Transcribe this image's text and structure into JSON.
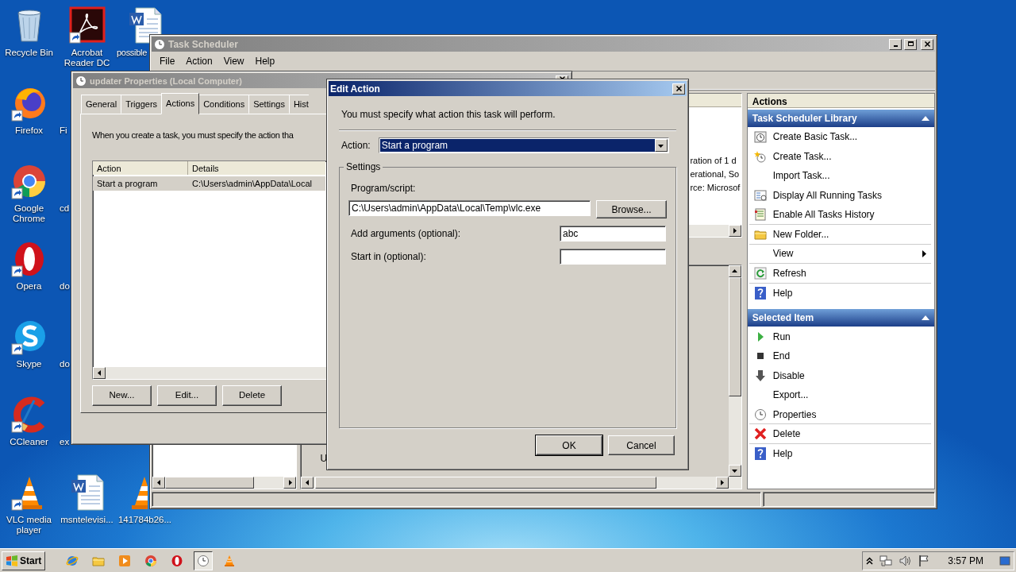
{
  "desktop": {
    "icon_columns": [
      [
        {
          "label": "Recycle Bin",
          "kind": "recycle",
          "shortcut": false
        },
        {
          "label": "Firefox",
          "kind": "firefox",
          "shortcut": true
        },
        {
          "label": "Google Chrome",
          "kind": "chrome",
          "shortcut": true
        },
        {
          "label": "Opera",
          "kind": "opera",
          "shortcut": true
        },
        {
          "label": "Skype",
          "kind": "skype",
          "shortcut": true
        },
        {
          "label": "CCleaner",
          "kind": "ccleaner",
          "shortcut": true
        },
        {
          "label": "VLC media player",
          "kind": "vlc",
          "shortcut": true
        }
      ],
      [
        {
          "label": "Acrobat Reader DC",
          "kind": "acrobat",
          "shortcut": true
        },
        {
          "label": "Fi"
        },
        {
          "label": "cd"
        },
        {
          "label": "do"
        },
        {
          "label": "do"
        },
        {
          "label": "ex"
        },
        {
          "label": "msntelevisi...",
          "kind": "word",
          "shortcut": false
        }
      ],
      [
        {
          "label": "possible",
          "kind": "word",
          "shortcut": false
        },
        {
          "label": "141784b26...",
          "kind": "vlc",
          "shortcut": false
        }
      ]
    ]
  },
  "task_scheduler": {
    "title": "Task Scheduler",
    "menu": [
      "File",
      "Action",
      "View",
      "Help"
    ],
    "center_text": [
      "ration of 1 d",
      "erational, So",
      "rce: Microsof"
    ],
    "lower_text": "U",
    "actions_header": "Actions",
    "action_sections": [
      {
        "title": "Task Scheduler Library",
        "expanded": true,
        "items": [
          {
            "label": "Create Basic Task...",
            "kind": "basic-task",
            "separator": false,
            "submenu": false
          },
          {
            "label": "Create Task...",
            "kind": "create-task",
            "separator": false,
            "submenu": false
          },
          {
            "label": "Import Task...",
            "separator": false,
            "submenu": false
          },
          {
            "label": "Display All Running Tasks",
            "kind": "running",
            "separator": false,
            "submenu": false
          },
          {
            "label": "Enable All Tasks History",
            "kind": "history",
            "separator": true,
            "submenu": false
          },
          {
            "label": "New Folder...",
            "kind": "folder",
            "separator": true,
            "submenu": false
          },
          {
            "label": "View",
            "separator": true,
            "submenu": true
          },
          {
            "label": "Refresh",
            "kind": "refresh",
            "separator": true,
            "submenu": false
          },
          {
            "label": "Help",
            "kind": "help",
            "separator": false,
            "submenu": false
          }
        ]
      },
      {
        "title": "Selected Item",
        "expanded": true,
        "items": [
          {
            "label": "Run",
            "kind": "run",
            "separator": false,
            "submenu": false
          },
          {
            "label": "End",
            "kind": "end",
            "separator": false,
            "submenu": false
          },
          {
            "label": "Disable",
            "kind": "disable",
            "separator": false,
            "submenu": false
          },
          {
            "label": "Export...",
            "separator": false,
            "submenu": false
          },
          {
            "label": "Properties",
            "kind": "properties",
            "separator": true,
            "submenu": false
          },
          {
            "label": "Delete",
            "kind": "delete",
            "separator": true,
            "submenu": false
          },
          {
            "label": "Help",
            "kind": "help",
            "separator": false,
            "submenu": false
          }
        ]
      }
    ]
  },
  "properties_window": {
    "title": "updater Properties (Local Computer)",
    "tabs": [
      {
        "label": "General",
        "selected": false
      },
      {
        "label": "Triggers",
        "selected": false
      },
      {
        "label": "Actions",
        "selected": true
      },
      {
        "label": "Conditions",
        "selected": false
      },
      {
        "label": "Settings",
        "selected": false
      },
      {
        "label": "Hist",
        "selected": false
      }
    ],
    "intro": "When you create a task, you must specify the action tha",
    "columns": [
      "Action",
      "Details"
    ],
    "rows": [
      {
        "cells": [
          "Start a program",
          "C:\\Users\\admin\\AppData\\Local"
        ],
        "selected": true
      }
    ],
    "buttons": [
      "New...",
      "Edit...",
      "Delete"
    ]
  },
  "edit_action": {
    "title": "Edit Action",
    "intro": "You must specify what action this task will perform.",
    "action_label": "Action:",
    "action_value": "Start a program",
    "group_title": "Settings",
    "program_label": "Program/script:",
    "program_value": "C:\\Users\\admin\\AppData\\Local\\Temp\\vlc.exe",
    "browse": "Browse...",
    "arguments_label": "Add arguments (optional):",
    "arguments_value": "abc",
    "start_in_label": "Start in (optional):",
    "ok": "OK",
    "cancel": "Cancel"
  },
  "taskbar": {
    "start": "Start",
    "apps": [
      {
        "kind": "ie",
        "active": false
      },
      {
        "kind": "explorer",
        "active": false
      },
      {
        "kind": "mediaplayer",
        "active": false
      },
      {
        "kind": "chrome",
        "active": false
      },
      {
        "kind": "opera",
        "active": false
      },
      {
        "kind": "clock",
        "active": true
      },
      {
        "kind": "vlc",
        "active": false
      }
    ],
    "time": "3:57 PM"
  }
}
